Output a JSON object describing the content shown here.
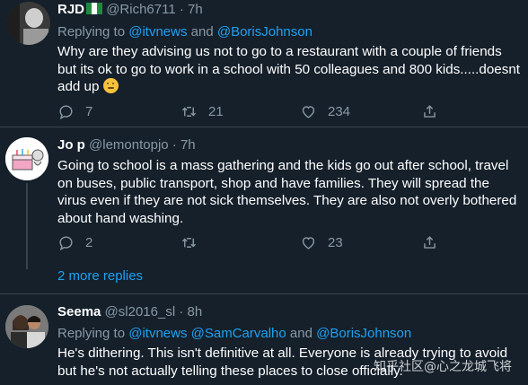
{
  "tweets": [
    {
      "name": "RJD",
      "handle": "@Rich6711",
      "time": "· 7h",
      "reply_prefix": "Replying to",
      "mentions": [
        "@itvnews",
        "@BorisJohnson"
      ],
      "mention_joiner": "and",
      "text": "Why are they advising us not to go to a restaurant with a couple of friends but its ok to go to work in a school with 50 colleagues and 800 kids.....doesnt add up",
      "replies": "7",
      "retweets": "21",
      "likes": "234",
      "avatar_icon": "person-photo-avatar",
      "flag_icon": "nigeria-flag-icon"
    },
    {
      "name": "Jo p",
      "handle": "@lemontopjo",
      "time": "· 7h",
      "text": "Going to school is a mass gathering and the kids go out after school, travel on buses, public transport, shop and have families. They will spread the virus even if they are not sick themselves. They are also not overly bothered about hand washing.",
      "replies": "2",
      "retweets": "",
      "likes": "23",
      "avatar_icon": "cake-drawing-avatar"
    },
    {
      "name": "Seema",
      "handle": "@sl2016_sl",
      "time": "· 8h",
      "reply_prefix": "Replying to",
      "mentions": [
        "@itvnews",
        "@SamCarvalho",
        "@BorisJohnson"
      ],
      "mention_joiner": "and",
      "text": "He's dithering.   This isn't definitive at all.  Everyone is already trying to avoid but he's not actually telling these places to close officially.",
      "avatar_icon": "couple-photo-avatar"
    }
  ],
  "more_replies": "2 more replies",
  "watermark": "知乎社区@心之龙城飞将",
  "colors": {
    "background": "#15202b",
    "text": "#ffffff",
    "muted": "#8899a6",
    "link": "#1da1f2",
    "divider": "#38444d"
  }
}
